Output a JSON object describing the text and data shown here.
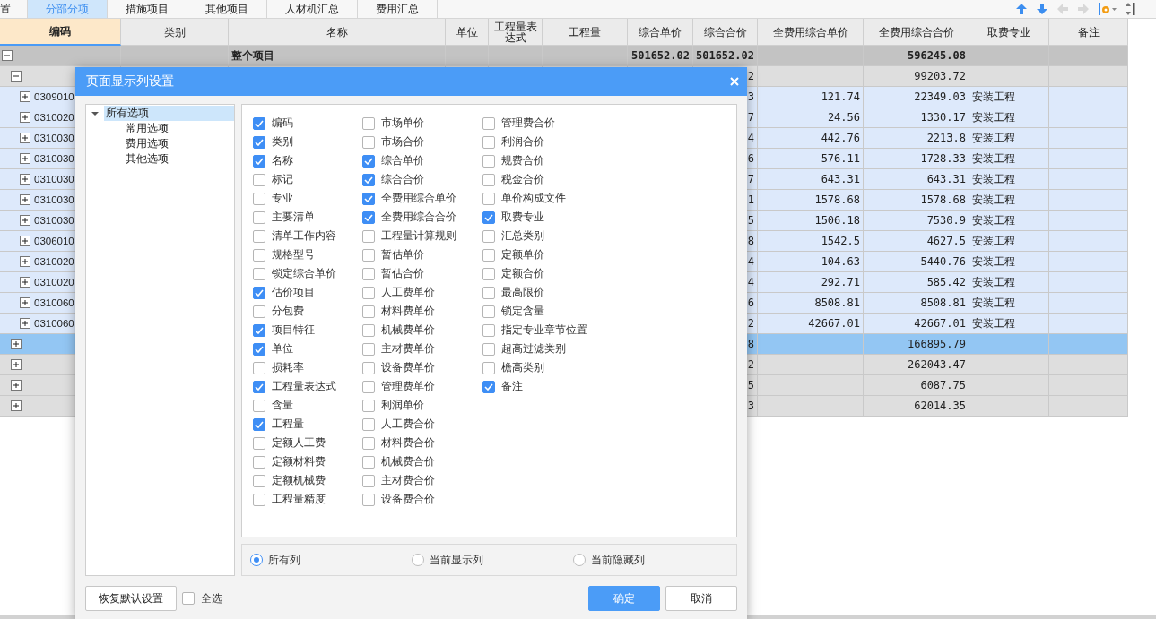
{
  "tabs": [
    {
      "label": "置",
      "selected": false
    },
    {
      "label": "分部分项",
      "selected": true
    },
    {
      "label": "措施项目",
      "selected": false
    },
    {
      "label": "其他项目",
      "selected": false
    },
    {
      "label": "人材机汇总",
      "selected": false
    },
    {
      "label": "费用汇总",
      "selected": false
    }
  ],
  "table": {
    "columns": [
      "编码",
      "类别",
      "名称",
      "单位",
      "工程量表达式",
      "工程量",
      "综合单价",
      "综合合价",
      "全费用综合单价",
      "全费用综合合价",
      "取费专业",
      "备注"
    ],
    "rows": [
      {
        "kind": "project",
        "selected": false,
        "expanded": true,
        "name": "整个项目",
        "unit_price": "501652.02",
        "total_price": "501652.02",
        "full_total_price": "596245.08",
        "children": [
          {
            "kind": "section",
            "selected": false,
            "expanded": true,
            "total_price": "2",
            "full_total_price": "99203.72",
            "children": [
              {
                "kind": "item",
                "selected": false,
                "expanded": false,
                "code": "0309010",
                "total_price": "3",
                "full_unit_price": "121.74",
                "full_total_price": "22349.03",
                "fee_specialty": "安装工程"
              },
              {
                "kind": "item",
                "selected": false,
                "expanded": false,
                "code": "0310020",
                "total_price": "7",
                "full_unit_price": "24.56",
                "full_total_price": "1330.17",
                "fee_specialty": "安装工程"
              },
              {
                "kind": "item",
                "selected": false,
                "expanded": false,
                "code": "0310030",
                "total_price": "4",
                "full_unit_price": "442.76",
                "full_total_price": "2213.8",
                "fee_specialty": "安装工程"
              },
              {
                "kind": "item",
                "selected": false,
                "expanded": false,
                "code": "0310030",
                "total_price": "6",
                "full_unit_price": "576.11",
                "full_total_price": "1728.33",
                "fee_specialty": "安装工程"
              },
              {
                "kind": "item",
                "selected": false,
                "expanded": false,
                "code": "0310030",
                "total_price": "7",
                "full_unit_price": "643.31",
                "full_total_price": "643.31",
                "fee_specialty": "安装工程"
              },
              {
                "kind": "item",
                "selected": false,
                "expanded": false,
                "code": "0310030",
                "total_price": "1",
                "full_unit_price": "1578.68",
                "full_total_price": "1578.68",
                "fee_specialty": "安装工程"
              },
              {
                "kind": "item",
                "selected": false,
                "expanded": false,
                "code": "0310030",
                "total_price": "5",
                "full_unit_price": "1506.18",
                "full_total_price": "7530.9",
                "fee_specialty": "安装工程"
              },
              {
                "kind": "item",
                "selected": false,
                "expanded": false,
                "code": "0306010",
                "total_price": "8",
                "full_unit_price": "1542.5",
                "full_total_price": "4627.5",
                "fee_specialty": "安装工程"
              },
              {
                "kind": "item",
                "selected": false,
                "expanded": false,
                "code": "0310020",
                "total_price": "4",
                "full_unit_price": "104.63",
                "full_total_price": "5440.76",
                "fee_specialty": "安装工程"
              },
              {
                "kind": "item",
                "selected": false,
                "expanded": false,
                "code": "0310020",
                "total_price": "4",
                "full_unit_price": "292.71",
                "full_total_price": "585.42",
                "fee_specialty": "安装工程"
              },
              {
                "kind": "item",
                "selected": false,
                "expanded": false,
                "code": "0310060",
                "total_price": "6",
                "full_unit_price": "8508.81",
                "full_total_price": "8508.81",
                "fee_specialty": "安装工程"
              },
              {
                "kind": "item",
                "selected": false,
                "expanded": false,
                "code": "0310060",
                "total_price": "2",
                "full_unit_price": "42667.01",
                "full_total_price": "42667.01",
                "fee_specialty": "安装工程"
              }
            ]
          },
          {
            "kind": "section",
            "selected": true,
            "expanded": false,
            "total_price": "8",
            "full_total_price": "166895.79"
          },
          {
            "kind": "section",
            "selected": false,
            "expanded": false,
            "total_price": "2",
            "full_total_price": "262043.47"
          },
          {
            "kind": "section",
            "selected": false,
            "expanded": false,
            "total_price": "5",
            "full_total_price": "6087.75"
          },
          {
            "kind": "section",
            "selected": false,
            "expanded": false,
            "total_price": "3",
            "full_total_price": "62014.35"
          }
        ]
      }
    ]
  },
  "dialog": {
    "title": "页面显示列设置",
    "tree": [
      {
        "label": "所有选项",
        "selected": true,
        "expanded": true,
        "children": [
          {
            "label": "常用选项",
            "selected": false
          },
          {
            "label": "费用选项",
            "selected": false
          },
          {
            "label": "其他选项",
            "selected": false
          }
        ]
      }
    ],
    "option_columns": [
      [
        {
          "label": "编码",
          "checked": true
        },
        {
          "label": "类别",
          "checked": true
        },
        {
          "label": "名称",
          "checked": true
        },
        {
          "label": "标记",
          "checked": false
        },
        {
          "label": "专业",
          "checked": false
        },
        {
          "label": "主要清单",
          "checked": false
        },
        {
          "label": "清单工作内容",
          "checked": false
        },
        {
          "label": "规格型号",
          "checked": false
        },
        {
          "label": "锁定综合单价",
          "checked": false
        },
        {
          "label": "估价项目",
          "checked": true
        },
        {
          "label": "分包费",
          "checked": false
        },
        {
          "label": "项目特征",
          "checked": true
        },
        {
          "label": "单位",
          "checked": true
        },
        {
          "label": "损耗率",
          "checked": false
        },
        {
          "label": "工程量表达式",
          "checked": true
        },
        {
          "label": "含量",
          "checked": false
        },
        {
          "label": "工程量",
          "checked": true
        },
        {
          "label": "定额人工费",
          "checked": false
        },
        {
          "label": "定额材料费",
          "checked": false
        },
        {
          "label": "定额机械费",
          "checked": false
        },
        {
          "label": "工程量精度",
          "checked": false
        }
      ],
      [
        {
          "label": "市场单价",
          "checked": false
        },
        {
          "label": "市场合价",
          "checked": false
        },
        {
          "label": "综合单价",
          "checked": true
        },
        {
          "label": "综合合价",
          "checked": true
        },
        {
          "label": "全费用综合单价",
          "checked": true
        },
        {
          "label": "全费用综合合价",
          "checked": true
        },
        {
          "label": "工程量计算规则",
          "checked": false
        },
        {
          "label": "暂估单价",
          "checked": false
        },
        {
          "label": "暂估合价",
          "checked": false
        },
        {
          "label": "人工费单价",
          "checked": false
        },
        {
          "label": "材料费单价",
          "checked": false
        },
        {
          "label": "机械费单价",
          "checked": false
        },
        {
          "label": "主材费单价",
          "checked": false
        },
        {
          "label": "设备费单价",
          "checked": false
        },
        {
          "label": "管理费单价",
          "checked": false
        },
        {
          "label": "利润单价",
          "checked": false
        },
        {
          "label": "人工费合价",
          "checked": false
        },
        {
          "label": "材料费合价",
          "checked": false
        },
        {
          "label": "机械费合价",
          "checked": false
        },
        {
          "label": "主材费合价",
          "checked": false
        },
        {
          "label": "设备费合价",
          "checked": false
        }
      ],
      [
        {
          "label": "管理费合价",
          "checked": false
        },
        {
          "label": "利润合价",
          "checked": false
        },
        {
          "label": "规费合价",
          "checked": false
        },
        {
          "label": "税金合价",
          "checked": false
        },
        {
          "label": "单价构成文件",
          "checked": false
        },
        {
          "label": "取费专业",
          "checked": true
        },
        {
          "label": "汇总类别",
          "checked": false
        },
        {
          "label": "定额单价",
          "checked": false
        },
        {
          "label": "定额合价",
          "checked": false
        },
        {
          "label": "最高限价",
          "checked": false
        },
        {
          "label": "锁定含量",
          "checked": false
        },
        {
          "label": "指定专业章节位置",
          "checked": false
        },
        {
          "label": "超高过滤类别",
          "checked": false
        },
        {
          "label": "檐高类别",
          "checked": false
        },
        {
          "label": "备注",
          "checked": true
        }
      ]
    ],
    "filters": [
      {
        "label": "所有列",
        "selected": true
      },
      {
        "label": "当前显示列",
        "selected": false
      },
      {
        "label": "当前隐藏列",
        "selected": false
      }
    ],
    "reset_button": "恢复默认设置",
    "select_all": {
      "label": "全选",
      "checked": false
    },
    "ok_button": "确定",
    "cancel_button": "取消"
  }
}
